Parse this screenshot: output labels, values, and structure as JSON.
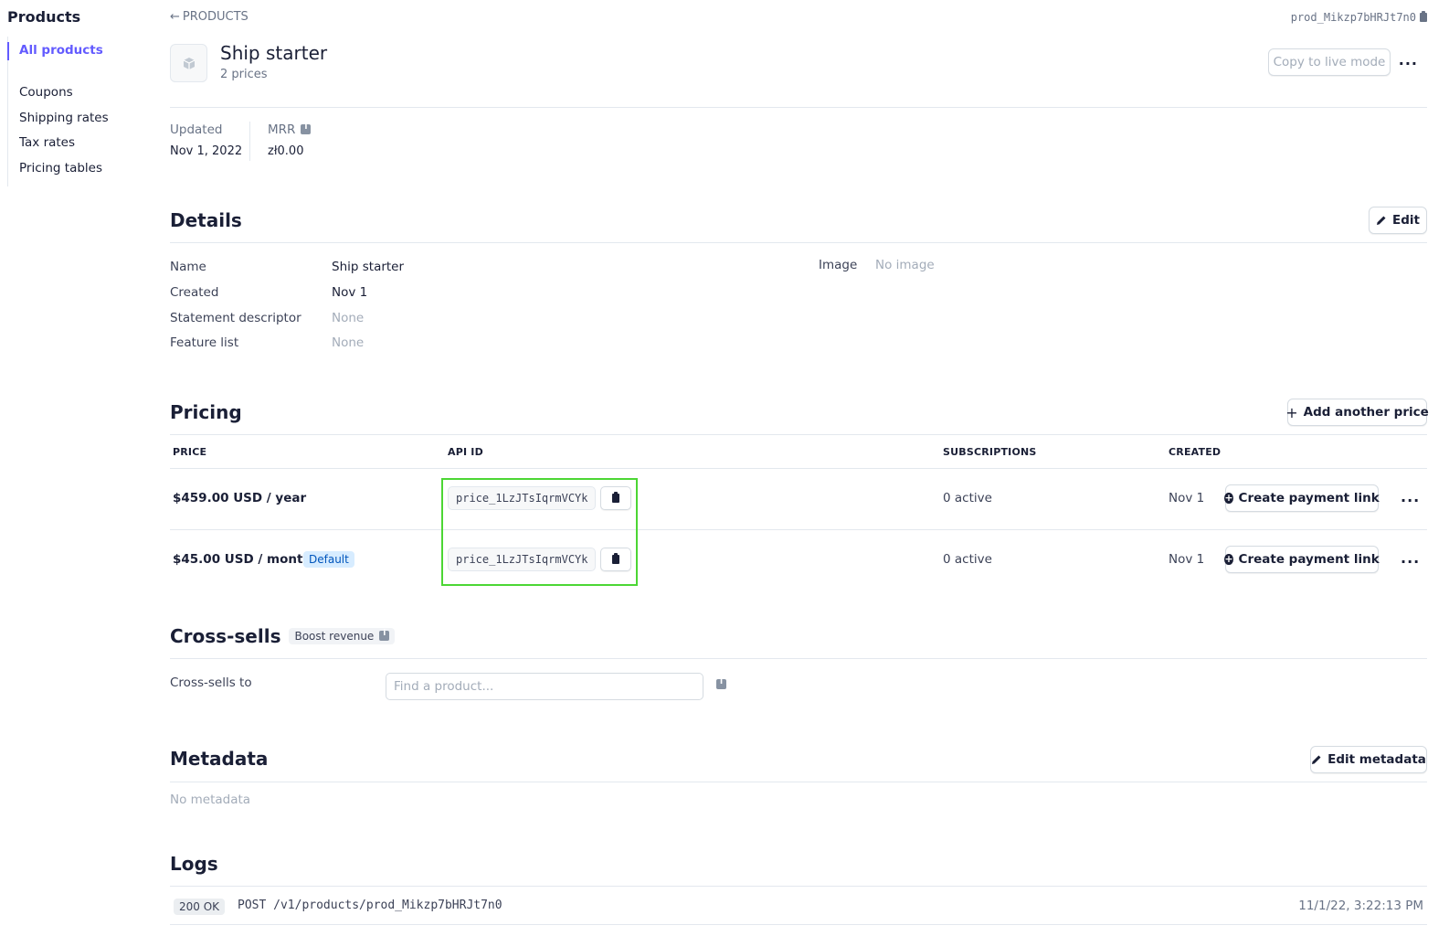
{
  "sidebar": {
    "title": "Products",
    "items": [
      {
        "label": "All products",
        "active": true
      },
      {
        "label": "Coupons"
      },
      {
        "label": "Shipping rates"
      },
      {
        "label": "Tax rates"
      },
      {
        "label": "Pricing tables"
      }
    ]
  },
  "header": {
    "breadcrumb": "PRODUCTS",
    "product_id": "prod_Mikzp7bHRJt7n0",
    "title": "Ship starter",
    "subtitle": "2 prices",
    "copy_live_label": "Copy to live mode",
    "more_label": "..."
  },
  "stats": {
    "updated_label": "Updated",
    "updated_value": "Nov 1, 2022",
    "mrr_label": "MRR",
    "mrr_value": "zł0.00"
  },
  "details": {
    "heading": "Details",
    "edit_label": "Edit",
    "rows": [
      {
        "label": "Name",
        "value": "Ship starter"
      },
      {
        "label": "Created",
        "value": "Nov 1"
      },
      {
        "label": "Statement descriptor",
        "value": "None"
      },
      {
        "label": "Feature list",
        "value": "None"
      }
    ],
    "image_label": "Image",
    "image_value": "No image"
  },
  "pricing": {
    "heading": "Pricing",
    "add_label": "Add another price",
    "columns": [
      "PRICE",
      "API ID",
      "SUBSCRIPTIONS",
      "CREATED"
    ],
    "rows": [
      {
        "price": "$459.00 USD / year",
        "api_id": "price_1LzJTsIqrmVCYk",
        "subscriptions": "0 active",
        "created": "Nov 1",
        "action": "Create payment link",
        "more": "..."
      },
      {
        "price": "$45.00 USD / month",
        "badge": "Default",
        "api_id": "price_1LzJTsIqrmVCYk",
        "subscriptions": "0 active",
        "created": "Nov 1",
        "action": "Create payment link",
        "more": "..."
      }
    ]
  },
  "cross_sells": {
    "heading": "Cross-sells",
    "badge": "Boost revenue",
    "label": "Cross-sells to",
    "placeholder": "Find a product..."
  },
  "metadata": {
    "heading": "Metadata",
    "edit_label": "Edit metadata",
    "empty": "No metadata"
  },
  "logs": {
    "heading": "Logs",
    "entries": [
      {
        "status": "200 OK",
        "request": "POST /v1/products/prod_Mikzp7bHRJt7n0",
        "time": "11/1/22, 3:22:13 PM"
      }
    ]
  },
  "colors": {
    "accent": "#635bff",
    "highlight_box": "#4cd634",
    "default_badge_bg": "#d7ecff"
  }
}
